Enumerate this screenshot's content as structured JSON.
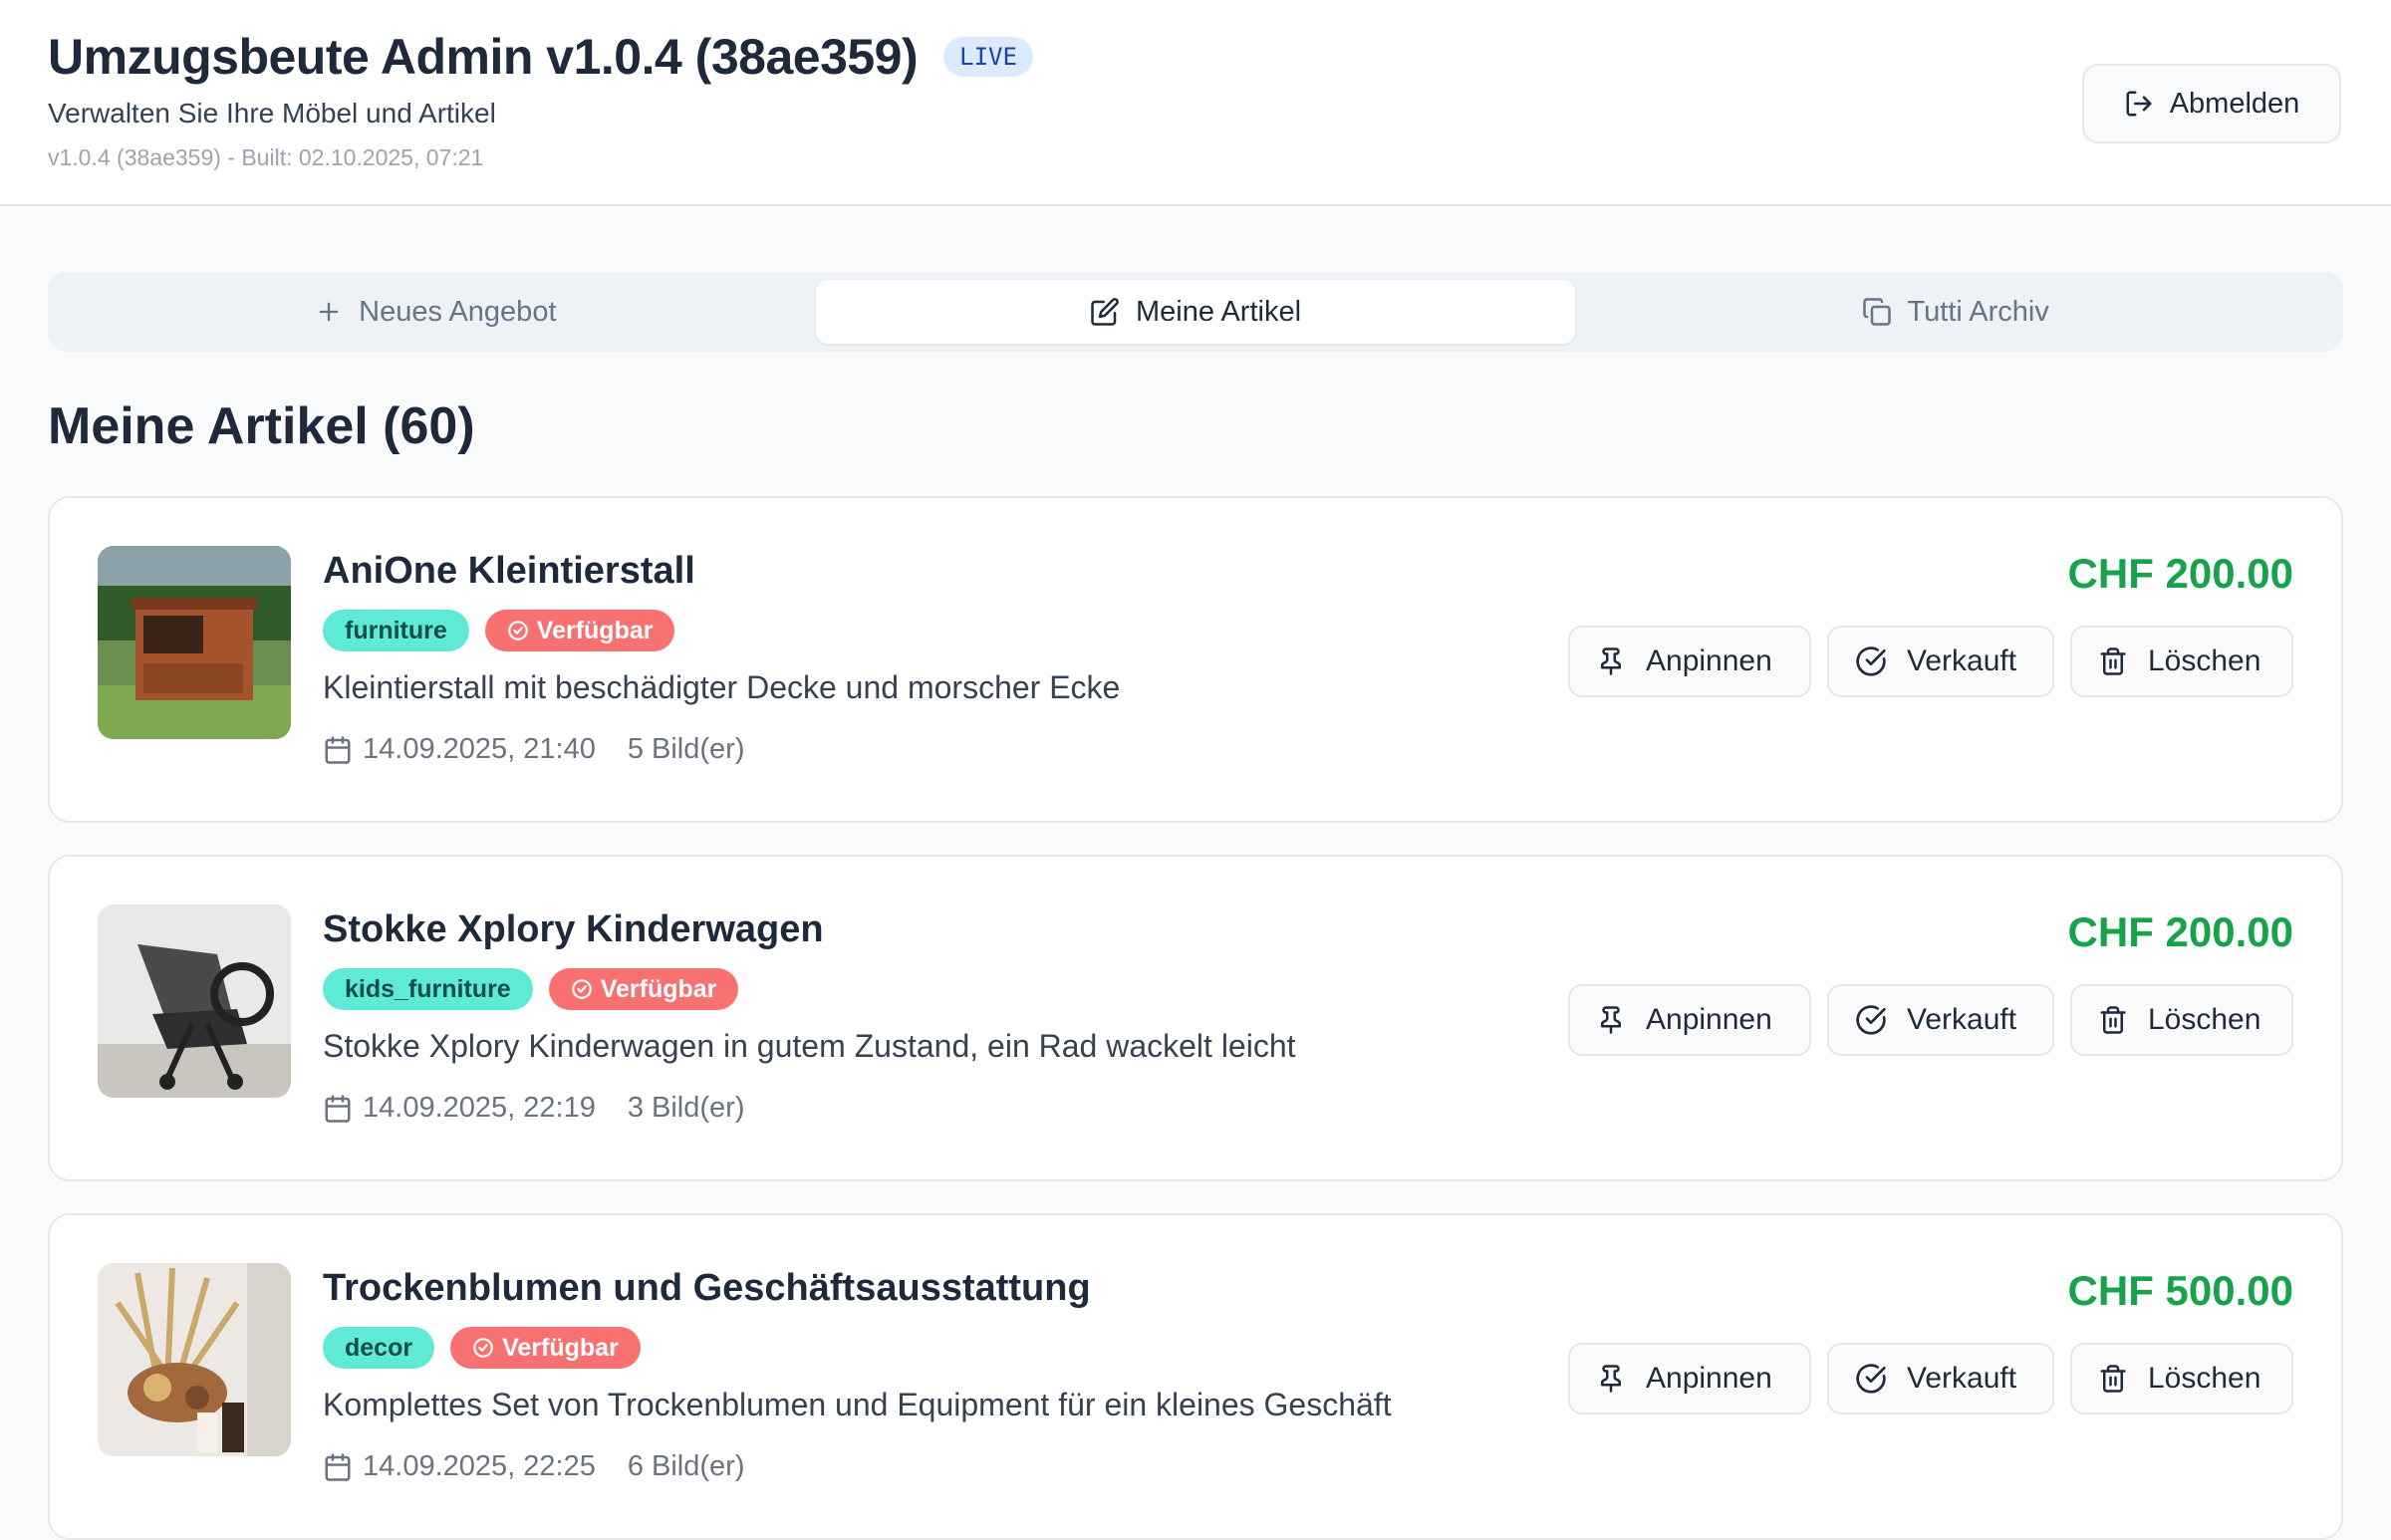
{
  "header": {
    "title": "Umzugsbeute Admin v1.0.4 (38ae359)",
    "badge": "LIVE",
    "subtitle": "Verwalten Sie Ihre Möbel und Artikel",
    "build_info": "v1.0.4 (38ae359) - Built: 02.10.2025, 07:21",
    "logout_label": "Abmelden"
  },
  "tabs": [
    {
      "label": "Neues Angebot",
      "icon": "plus-icon",
      "active": false
    },
    {
      "label": "Meine Artikel",
      "icon": "edit-icon",
      "active": true
    },
    {
      "label": "Tutti Archiv",
      "icon": "copy-icon",
      "active": false
    }
  ],
  "section": {
    "title": "Meine Artikel (60)"
  },
  "actions": {
    "pin": "Anpinnen",
    "sold": "Verkauft",
    "delete": "Löschen"
  },
  "items": [
    {
      "title": "AniOne Kleintierstall",
      "category": "furniture",
      "status": "Verfügbar",
      "description": "Kleintierstall mit beschädigter Decke und morscher Ecke",
      "date": "14.09.2025, 21:40",
      "images": "5 Bild(er)",
      "price": "CHF 200.00"
    },
    {
      "title": "Stokke Xplory Kinderwagen",
      "category": "kids_furniture",
      "status": "Verfügbar",
      "description": "Stokke Xplory Kinderwagen in gutem Zustand, ein Rad wackelt leicht",
      "date": "14.09.2025, 22:19",
      "images": "3 Bild(er)",
      "price": "CHF 200.00"
    },
    {
      "title": "Trockenblumen und Geschäftsausstattung",
      "category": "decor",
      "status": "Verfügbar",
      "description": "Komplettes Set von Trockenblumen und Equipment für ein kleines Geschäft",
      "date": "14.09.2025, 22:25",
      "images": "6 Bild(er)",
      "price": "CHF 500.00"
    }
  ],
  "colors": {
    "accent_green": "#16a34a",
    "tag_category": "#5eead4",
    "tag_status": "#f87171",
    "badge_blue": "#dbeafe"
  }
}
